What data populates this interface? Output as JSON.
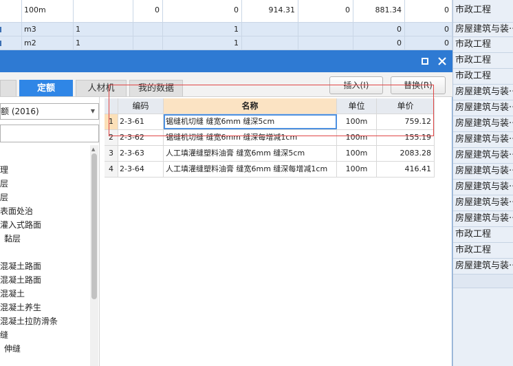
{
  "background": {
    "rows": [
      {
        "unit": "100m",
        "a": "",
        "b": "0",
        "c": "0",
        "d": "914.31",
        "e": "0",
        "f": "881.34",
        "g": "0"
      },
      {
        "unit": "m3",
        "a": "1",
        "b": "",
        "c": "1",
        "d": "",
        "e": "",
        "f": "0",
        "g": "0"
      },
      {
        "unit": "m2",
        "a": "1",
        "b": "",
        "c": "1",
        "d": "",
        "e": "",
        "f": "0",
        "g": "0"
      }
    ],
    "right_column": [
      "市政工程",
      "房屋建筑与装···",
      "市政工程",
      "市政工程",
      "市政工程",
      "房屋建筑与装···",
      "房屋建筑与装···",
      "房屋建筑与装···",
      "房屋建筑与装···",
      "房屋建筑与装···",
      "房屋建筑与装···",
      "房屋建筑与装···",
      "房屋建筑与装···",
      "房屋建筑与装···",
      "市政工程",
      "市政工程",
      "房屋建筑与装···"
    ]
  },
  "dialog": {
    "titlebar": {
      "maximize_icon": "maximize-icon",
      "close_icon": "close-icon"
    },
    "tabs": [
      {
        "label": "",
        "active": false
      },
      {
        "label": "定额",
        "active": true
      },
      {
        "label": "人材机",
        "active": false
      },
      {
        "label": "我的数据",
        "active": false
      }
    ],
    "insert_label": "插入(I)",
    "replace_label": "替换(R)",
    "left_panel": {
      "combo_value": "额 (2016)",
      "search_value": "",
      "tree_items": [
        "",
        "理",
        "层",
        "层",
        "表面处治",
        "灌入式路面",
        "黏层",
        "",
        "混凝土路面",
        "混凝土路面",
        "混凝土",
        "混凝土养生",
        "混凝土拉防滑条",
        "缝",
        "伸缝"
      ]
    },
    "table": {
      "headers": [
        "编码",
        "名称",
        "单位",
        "单价"
      ],
      "rows": [
        {
          "num": "1",
          "code": "2-3-61",
          "name": "锯缝机切缝 缝宽6mm 缝深5cm",
          "unit": "100m",
          "price": "759.12"
        },
        {
          "num": "2",
          "code": "2-3-62",
          "name": "锯缝机切缝 缝宽6mm 缝深每增减1cm",
          "unit": "100m",
          "price": "155.19"
        },
        {
          "num": "3",
          "code": "2-3-63",
          "name": "人工填灌缝塑料油膏 缝宽6mm 缝深5cm",
          "unit": "100m",
          "price": "2083.28"
        },
        {
          "num": "4",
          "code": "2-3-64",
          "name": "人工填灌缝塑料油膏 缝宽6mm 缝深每增减1cm",
          "unit": "100m",
          "price": "416.41"
        }
      ]
    }
  },
  "colors": {
    "titlebar": "#2e7ad3",
    "active_tab": "#2f86e6",
    "highlight_frame": "#e04545",
    "selected_row": "#fbe0b8"
  }
}
